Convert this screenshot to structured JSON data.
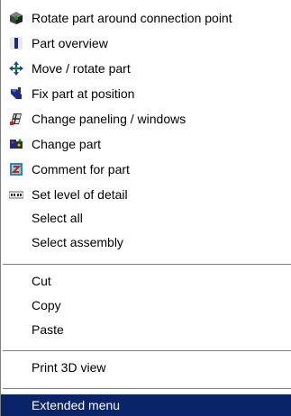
{
  "menu": {
    "items": [
      {
        "label": "Rotate part around connection point",
        "icon": "rotate-part-icon"
      },
      {
        "label": "Part overview",
        "icon": "part-overview-icon"
      },
      {
        "label": "Move / rotate part",
        "icon": "move-rotate-icon"
      },
      {
        "label": "Fix part at position",
        "icon": "fix-part-icon"
      },
      {
        "label": "Change paneling / windows",
        "icon": "paneling-icon"
      },
      {
        "label": "Change part",
        "icon": "change-part-icon"
      },
      {
        "label": "Comment for part",
        "icon": "comment-icon"
      },
      {
        "label": "Set level of detail",
        "icon": "level-of-detail-icon"
      },
      {
        "label": "Select all"
      },
      {
        "label": "Select assembly"
      },
      {
        "label": "Cut"
      },
      {
        "label": "Copy"
      },
      {
        "label": "Paste"
      },
      {
        "label": "Print 3D view"
      },
      {
        "label": "Extended menu",
        "highlighted": true
      }
    ],
    "highlight_color": "#0a246a",
    "separator_color": "#808080"
  }
}
